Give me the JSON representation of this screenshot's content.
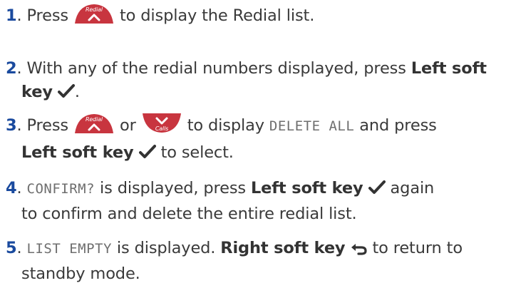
{
  "steps": [
    {
      "number": "1",
      "t1": ". Press ",
      "redial_key": "Redial",
      "t2": " to display the Redial list."
    },
    {
      "number": "2",
      "t1": ". With any of the redial numbers displayed, press ",
      "b1": "Left soft",
      "b2": "key",
      "t2": "."
    },
    {
      "number": "3",
      "t1": ". Press ",
      "redial_key": "Redial",
      "t2": " or ",
      "calls_key": "Calls",
      "t3": " to display ",
      "lcd": "DELETE ALL",
      "t4": " and press",
      "b1": "Left soft key",
      "t5": " to select."
    },
    {
      "number": "4",
      "t1": ". ",
      "lcd": "CONFIRM?",
      "t2": " is displayed, press ",
      "b1": "Left soft key",
      "t3": " again",
      "t4": "to confirm and delete the entire redial list."
    },
    {
      "number": "5",
      "t1": ". ",
      "lcd": "LIST EMPTY",
      "t2": " is displayed. ",
      "b1": "Right soft key",
      "t3": " to return to",
      "t4": "standby mode."
    }
  ],
  "colors": {
    "number": "#1a4a9e",
    "key_fill": "#c8353f",
    "text": "#3a3a3a"
  },
  "icons": [
    "redial-key-icon",
    "calls-key-icon",
    "checkmark-icon",
    "back-arrow-icon"
  ]
}
